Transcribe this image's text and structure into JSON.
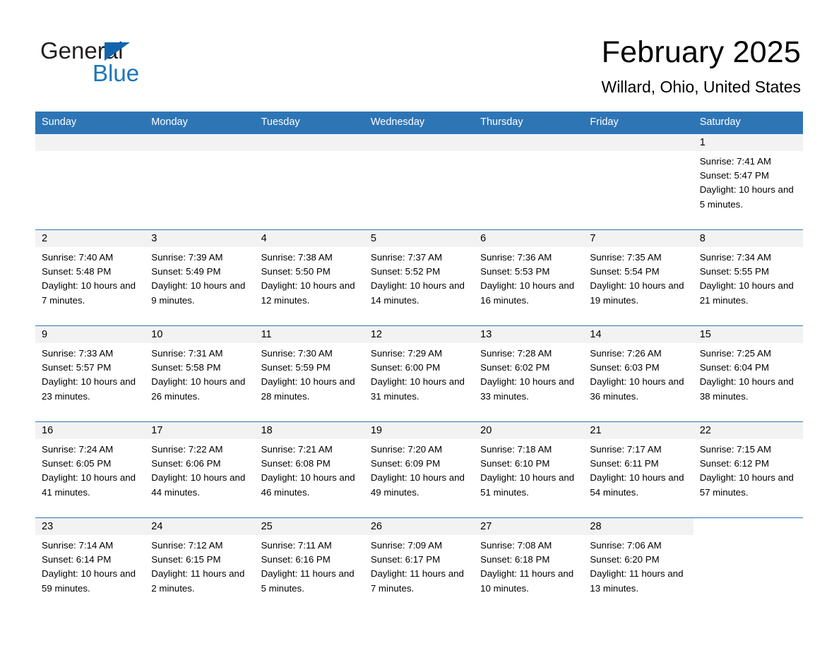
{
  "brand": {
    "name_part1": "General",
    "name_part2": "Blue",
    "accent_color": "#1b75bb",
    "triangle_color": "#1264ad"
  },
  "header": {
    "month_title": "February 2025",
    "location": "Willard, Ohio, United States",
    "header_bg": "#2e75b6",
    "daynum_bg": "#f2f2f2"
  },
  "weekday_headers": [
    "Sunday",
    "Monday",
    "Tuesday",
    "Wednesday",
    "Thursday",
    "Friday",
    "Saturday"
  ],
  "weeks": [
    [
      {
        "day": "",
        "empty": true
      },
      {
        "day": "",
        "empty": true
      },
      {
        "day": "",
        "empty": true
      },
      {
        "day": "",
        "empty": true
      },
      {
        "day": "",
        "empty": true
      },
      {
        "day": "",
        "empty": true
      },
      {
        "day": "1",
        "sunrise": "Sunrise: 7:41 AM",
        "sunset": "Sunset: 5:47 PM",
        "daylight": "Daylight: 10 hours and 5 minutes."
      }
    ],
    [
      {
        "day": "2",
        "sunrise": "Sunrise: 7:40 AM",
        "sunset": "Sunset: 5:48 PM",
        "daylight": "Daylight: 10 hours and 7 minutes."
      },
      {
        "day": "3",
        "sunrise": "Sunrise: 7:39 AM",
        "sunset": "Sunset: 5:49 PM",
        "daylight": "Daylight: 10 hours and 9 minutes."
      },
      {
        "day": "4",
        "sunrise": "Sunrise: 7:38 AM",
        "sunset": "Sunset: 5:50 PM",
        "daylight": "Daylight: 10 hours and 12 minutes."
      },
      {
        "day": "5",
        "sunrise": "Sunrise: 7:37 AM",
        "sunset": "Sunset: 5:52 PM",
        "daylight": "Daylight: 10 hours and 14 minutes."
      },
      {
        "day": "6",
        "sunrise": "Sunrise: 7:36 AM",
        "sunset": "Sunset: 5:53 PM",
        "daylight": "Daylight: 10 hours and 16 minutes."
      },
      {
        "day": "7",
        "sunrise": "Sunrise: 7:35 AM",
        "sunset": "Sunset: 5:54 PM",
        "daylight": "Daylight: 10 hours and 19 minutes."
      },
      {
        "day": "8",
        "sunrise": "Sunrise: 7:34 AM",
        "sunset": "Sunset: 5:55 PM",
        "daylight": "Daylight: 10 hours and 21 minutes."
      }
    ],
    [
      {
        "day": "9",
        "sunrise": "Sunrise: 7:33 AM",
        "sunset": "Sunset: 5:57 PM",
        "daylight": "Daylight: 10 hours and 23 minutes."
      },
      {
        "day": "10",
        "sunrise": "Sunrise: 7:31 AM",
        "sunset": "Sunset: 5:58 PM",
        "daylight": "Daylight: 10 hours and 26 minutes."
      },
      {
        "day": "11",
        "sunrise": "Sunrise: 7:30 AM",
        "sunset": "Sunset: 5:59 PM",
        "daylight": "Daylight: 10 hours and 28 minutes."
      },
      {
        "day": "12",
        "sunrise": "Sunrise: 7:29 AM",
        "sunset": "Sunset: 6:00 PM",
        "daylight": "Daylight: 10 hours and 31 minutes."
      },
      {
        "day": "13",
        "sunrise": "Sunrise: 7:28 AM",
        "sunset": "Sunset: 6:02 PM",
        "daylight": "Daylight: 10 hours and 33 minutes."
      },
      {
        "day": "14",
        "sunrise": "Sunrise: 7:26 AM",
        "sunset": "Sunset: 6:03 PM",
        "daylight": "Daylight: 10 hours and 36 minutes."
      },
      {
        "day": "15",
        "sunrise": "Sunrise: 7:25 AM",
        "sunset": "Sunset: 6:04 PM",
        "daylight": "Daylight: 10 hours and 38 minutes."
      }
    ],
    [
      {
        "day": "16",
        "sunrise": "Sunrise: 7:24 AM",
        "sunset": "Sunset: 6:05 PM",
        "daylight": "Daylight: 10 hours and 41 minutes."
      },
      {
        "day": "17",
        "sunrise": "Sunrise: 7:22 AM",
        "sunset": "Sunset: 6:06 PM",
        "daylight": "Daylight: 10 hours and 44 minutes."
      },
      {
        "day": "18",
        "sunrise": "Sunrise: 7:21 AM",
        "sunset": "Sunset: 6:08 PM",
        "daylight": "Daylight: 10 hours and 46 minutes."
      },
      {
        "day": "19",
        "sunrise": "Sunrise: 7:20 AM",
        "sunset": "Sunset: 6:09 PM",
        "daylight": "Daylight: 10 hours and 49 minutes."
      },
      {
        "day": "20",
        "sunrise": "Sunrise: 7:18 AM",
        "sunset": "Sunset: 6:10 PM",
        "daylight": "Daylight: 10 hours and 51 minutes."
      },
      {
        "day": "21",
        "sunrise": "Sunrise: 7:17 AM",
        "sunset": "Sunset: 6:11 PM",
        "daylight": "Daylight: 10 hours and 54 minutes."
      },
      {
        "day": "22",
        "sunrise": "Sunrise: 7:15 AM",
        "sunset": "Sunset: 6:12 PM",
        "daylight": "Daylight: 10 hours and 57 minutes."
      }
    ],
    [
      {
        "day": "23",
        "sunrise": "Sunrise: 7:14 AM",
        "sunset": "Sunset: 6:14 PM",
        "daylight": "Daylight: 10 hours and 59 minutes."
      },
      {
        "day": "24",
        "sunrise": "Sunrise: 7:12 AM",
        "sunset": "Sunset: 6:15 PM",
        "daylight": "Daylight: 11 hours and 2 minutes."
      },
      {
        "day": "25",
        "sunrise": "Sunrise: 7:11 AM",
        "sunset": "Sunset: 6:16 PM",
        "daylight": "Daylight: 11 hours and 5 minutes."
      },
      {
        "day": "26",
        "sunrise": "Sunrise: 7:09 AM",
        "sunset": "Sunset: 6:17 PM",
        "daylight": "Daylight: 11 hours and 7 minutes."
      },
      {
        "day": "27",
        "sunrise": "Sunrise: 7:08 AM",
        "sunset": "Sunset: 6:18 PM",
        "daylight": "Daylight: 11 hours and 10 minutes."
      },
      {
        "day": "28",
        "sunrise": "Sunrise: 7:06 AM",
        "sunset": "Sunset: 6:20 PM",
        "daylight": "Daylight: 11 hours and 13 minutes."
      },
      {
        "day": "",
        "empty": true
      }
    ]
  ]
}
